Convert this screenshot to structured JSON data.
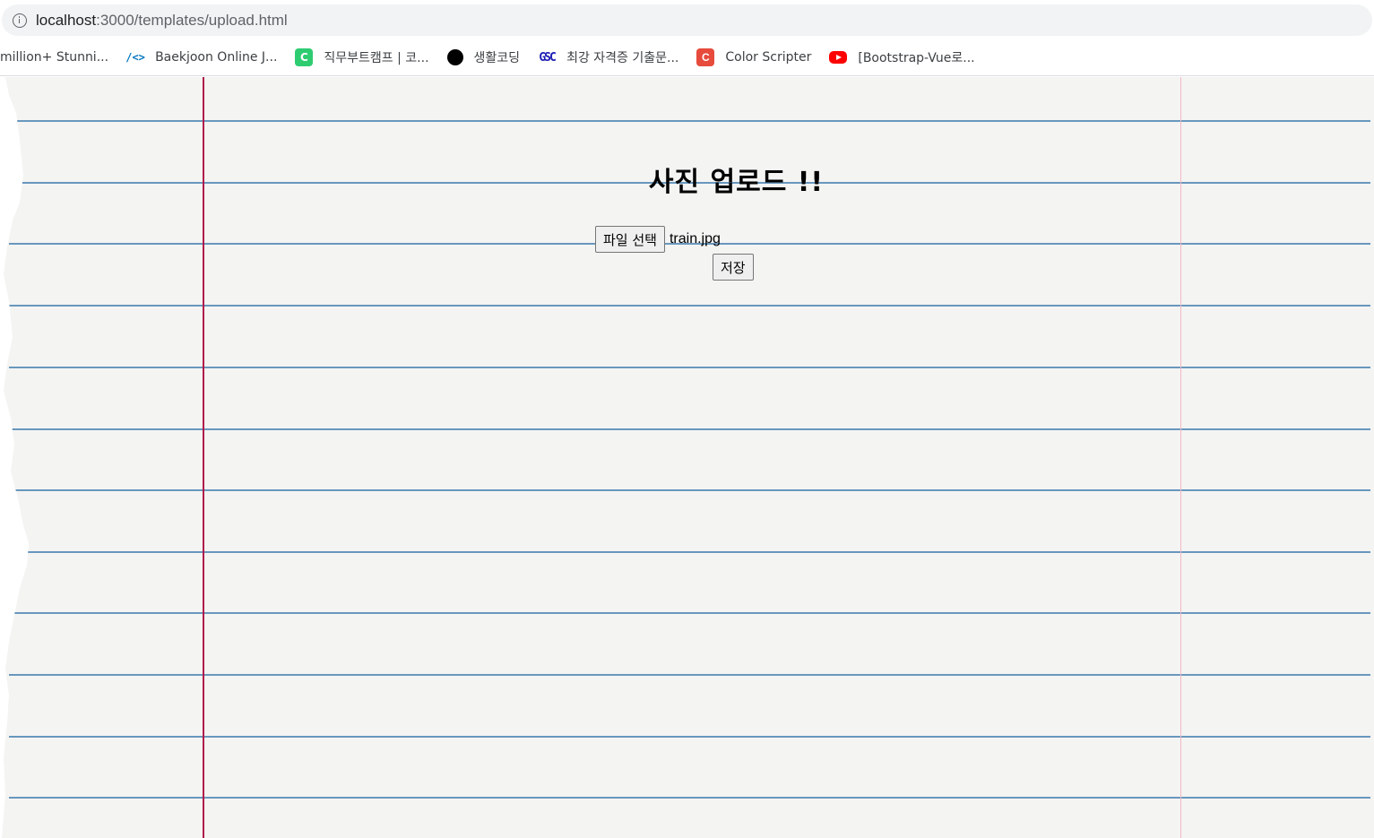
{
  "browser": {
    "url_host": "localhost",
    "url_path": ":3000/templates/upload.html"
  },
  "bookmarks": [
    {
      "label": "million+ Stunni...",
      "icon": "none"
    },
    {
      "label": "Baekjoon Online J...",
      "icon": "code-icon",
      "glyph": "/<>"
    },
    {
      "label": "직무부트캠프 | 코...",
      "icon": "green-app-icon",
      "glyph": "C"
    },
    {
      "label": "생활코딩",
      "icon": "black-circle-icon",
      "glyph": ""
    },
    {
      "label": "최강 자격증 기출문...",
      "icon": "gsc-icon",
      "glyph": "GSC"
    },
    {
      "label": "Color Scripter",
      "icon": "color-scripter-icon",
      "glyph": "C"
    },
    {
      "label": "[Bootstrap-Vue로...",
      "icon": "youtube-icon",
      "glyph": ""
    }
  ],
  "page": {
    "title": "사진 업로드 !!",
    "file_button_label": "파일 선택",
    "file_name": "train.jpg",
    "save_label": "저장"
  },
  "colors": {
    "ruled_line": "#4f86b3",
    "margin_line": "#b0194a",
    "paper": "#f4f4f3"
  }
}
